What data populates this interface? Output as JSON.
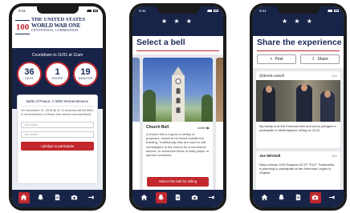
{
  "status": {
    "time": "9:41"
  },
  "phone1": {
    "logo_number": "100",
    "logo_line1": "THE UNITED STATES",
    "logo_line2": "WORLD WAR ONE",
    "logo_line3": "CENTENNIAL COMMISSION",
    "countdown_title": "Countdown to 11/01 at 11am",
    "days": "36",
    "days_label": "DAYS",
    "hours": "1",
    "hours_label": "HOURS",
    "minutes": "19",
    "minutes_label": "MINUTES",
    "card_title": "Bells of Peace: A WWI Remembrance",
    "card_text": "On November 11, 2018 @ 11 11 America will toll bells in remembrance of those who served and sacrificed.",
    "name_placeholder": "Your name",
    "email_placeholder": "Your email",
    "pledge_button": "I pledge to participate"
  },
  "phone2": {
    "stars": "★ ★ ★",
    "headline": "Select a bell",
    "bell_title": "Church Bell",
    "listen_label": "Listen ▶",
    "bell_description": "A church bell a ring for a variety of purposes, meant to be heard outside the building. Traditionally they are used to call worshippers to the church for a communal service, to announce times of daily prayer or special occasions.",
    "select_button": "Select this bell for tolling"
  },
  "phone3": {
    "stars": "★ ★ ★",
    "headline": "Share the experience",
    "post_button": "Post",
    "share_button": "Share",
    "post1_user": "@derek.russell",
    "post1_meta": "22m",
    "post1_text": "My family is at the Freedom Bell and we've pledged to participate in #belloftpeace tolling on 11/11.",
    "post2_user": "Joe Mitchell",
    "post2_meta": "45m",
    "post2_text": "Navy veteran USS Burgess 03 ST \"EUC\" Submarine, is planning to participate at the American Legion in Virginia."
  },
  "tabs": [
    "home-icon",
    "bell-icon",
    "document-icon",
    "camera-icon",
    "bugle-icon"
  ],
  "colors": {
    "navy": "#182348",
    "red": "#c1272d"
  }
}
